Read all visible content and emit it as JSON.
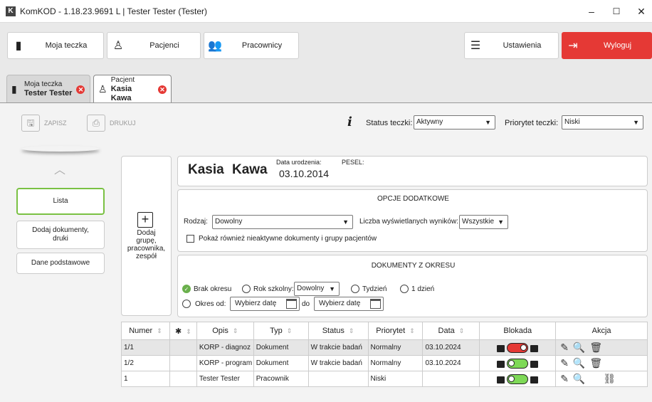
{
  "window": {
    "title": "KomKOD - 1.18.23.9691 L | Tester Tester (Tester)",
    "logo": "K",
    "minimize": "–",
    "maximize": "☐",
    "close": "✕"
  },
  "topnav": {
    "moja_teczka": "Moja teczka",
    "pacjenci": "Pacjenci",
    "pracownicy": "Pracownicy",
    "ustawienia": "Ustawienia",
    "wyloguj": "Wyloguj"
  },
  "tabs": [
    {
      "line1": "Moja teczka",
      "line2": "Tester Tester",
      "icon": "folder-icon"
    },
    {
      "line1": "Pacjent",
      "line2": "Kasia Kawa",
      "icon": "person-icon"
    }
  ],
  "toolbar": {
    "zapisz": "ZAPISZ",
    "drukuj": "DRUKUJ",
    "info": "i",
    "status_label": "Status teczki:",
    "status_value": "Aktywny",
    "priorytet_label": "Priorytet teczki:",
    "priorytet_value": "Niski"
  },
  "sidebar": {
    "items": [
      "Lista",
      "Dodaj dokumenty,\ndruki",
      "Dane podstawowe"
    ],
    "active": "Lista"
  },
  "add_group": {
    "icon": "+",
    "label": "Dodaj\ngrupę,\npracownika,\nzespół"
  },
  "patient": {
    "first_name": "Kasia",
    "last_name": "Kawa",
    "dob_label": "Data urodzenia:",
    "dob_value": "03.10.2014",
    "pesel_label": "PESEL:"
  },
  "options": {
    "title": "OPCJE DODATKOWE",
    "rodzaj_label": "Rodzaj:",
    "rodzaj_value": "Dowolny",
    "liczba_label": "Liczba wyświetlanych wyników:",
    "liczba_value": "Wszystkie",
    "inactive_label": "Pokaż również nieaktywne dokumenty i grupy pacjentów"
  },
  "period": {
    "title": "DOKUMENTY Z OKRESU",
    "brak_okresu": "Brak okresu",
    "rok_szkolny": "Rok szkolny:",
    "rok_value": "Dowolny",
    "tydzien": "Tydzień",
    "dzien": "1 dzień",
    "okres_od": "Okres od:",
    "wybierz": "Wybierz datę",
    "do": "do"
  },
  "table": {
    "headers": [
      "Numer",
      "📌",
      "Opis",
      "Typ",
      "Status",
      "Priorytet",
      "Data",
      "Blokada",
      "Akcja"
    ],
    "rows": [
      {
        "numer": "1/1",
        "opis": "KORP - diagnoz",
        "typ": "Dokument",
        "status": "W trakcie badań",
        "priorytet": "Normalny",
        "data": "03.10.2024",
        "locked": true
      },
      {
        "numer": "1/2",
        "opis": "KORP - program",
        "typ": "Dokument",
        "status": "W trakcie badań",
        "priorytet": "Normalny",
        "data": "03.10.2024",
        "locked": false
      },
      {
        "numer": "1",
        "opis": "Tester Tester",
        "typ": "Pracownik",
        "status": "",
        "priorytet": "Niski",
        "data": "",
        "locked": false
      }
    ]
  },
  "colors": {
    "accent_green": "#7ac143",
    "logout_red": "#e53935",
    "toggle_on": "#e53935",
    "toggle_off": "#7ed957"
  }
}
